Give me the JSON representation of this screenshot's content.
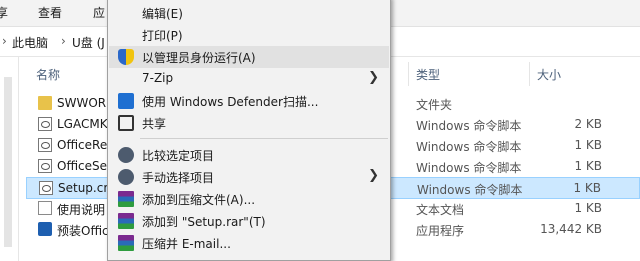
{
  "ribbon": {
    "tabs": [
      "享",
      "查看",
      "应"
    ]
  },
  "address": {
    "crumbs": [
      "此电脑",
      "U盘 (J"
    ]
  },
  "columns": {
    "name": "名称",
    "type": "类型",
    "size": "大小"
  },
  "files": [
    {
      "name": "SWWOR",
      "type": "文件夹",
      "size": "",
      "icon": "folder-icon"
    },
    {
      "name": "LGACMK",
      "type": "Windows 命令脚本",
      "size": "2 KB",
      "icon": "script-icon"
    },
    {
      "name": "OfficeRe",
      "type": "Windows 命令脚本",
      "size": "1 KB",
      "icon": "script-icon"
    },
    {
      "name": "OfficeSe",
      "type": "Windows 命令脚本",
      "size": "1 KB",
      "icon": "script-icon"
    },
    {
      "name": "Setup.cm",
      "type": "Windows 命令脚本",
      "size": "1 KB",
      "icon": "script-icon",
      "selected": true
    },
    {
      "name": "使用说明",
      "type": "文本文档",
      "size": "1 KB",
      "icon": "document-icon"
    },
    {
      "name": "预装Offic",
      "type": "应用程序",
      "size": "13,442 KB",
      "icon": "app-icon"
    }
  ],
  "context_menu": {
    "items": [
      {
        "label": "编辑(E)"
      },
      {
        "label": "打印(P)"
      },
      {
        "label": "以管理员身份运行(A)",
        "icon": "admin-shield-icon",
        "highlighted": true
      },
      {
        "label": "7-Zip",
        "submenu": true
      },
      {
        "label": "使用 Windows Defender扫描...",
        "icon": "defender-icon"
      },
      {
        "label": "共享",
        "icon": "share-icon"
      },
      {
        "label": "比较选定项目",
        "icon": "compare-icon"
      },
      {
        "label": "手动选择项目",
        "icon": "compare-icon",
        "submenu": true
      },
      {
        "label": "添加到压缩文件(A)...",
        "icon": "winrar-icon"
      },
      {
        "label": "添加到 \"Setup.rar\"(T)",
        "icon": "winrar-icon"
      },
      {
        "label": "压缩并 E-mail...",
        "icon": "winrar-icon"
      }
    ],
    "arrow_glyph": "❯"
  }
}
